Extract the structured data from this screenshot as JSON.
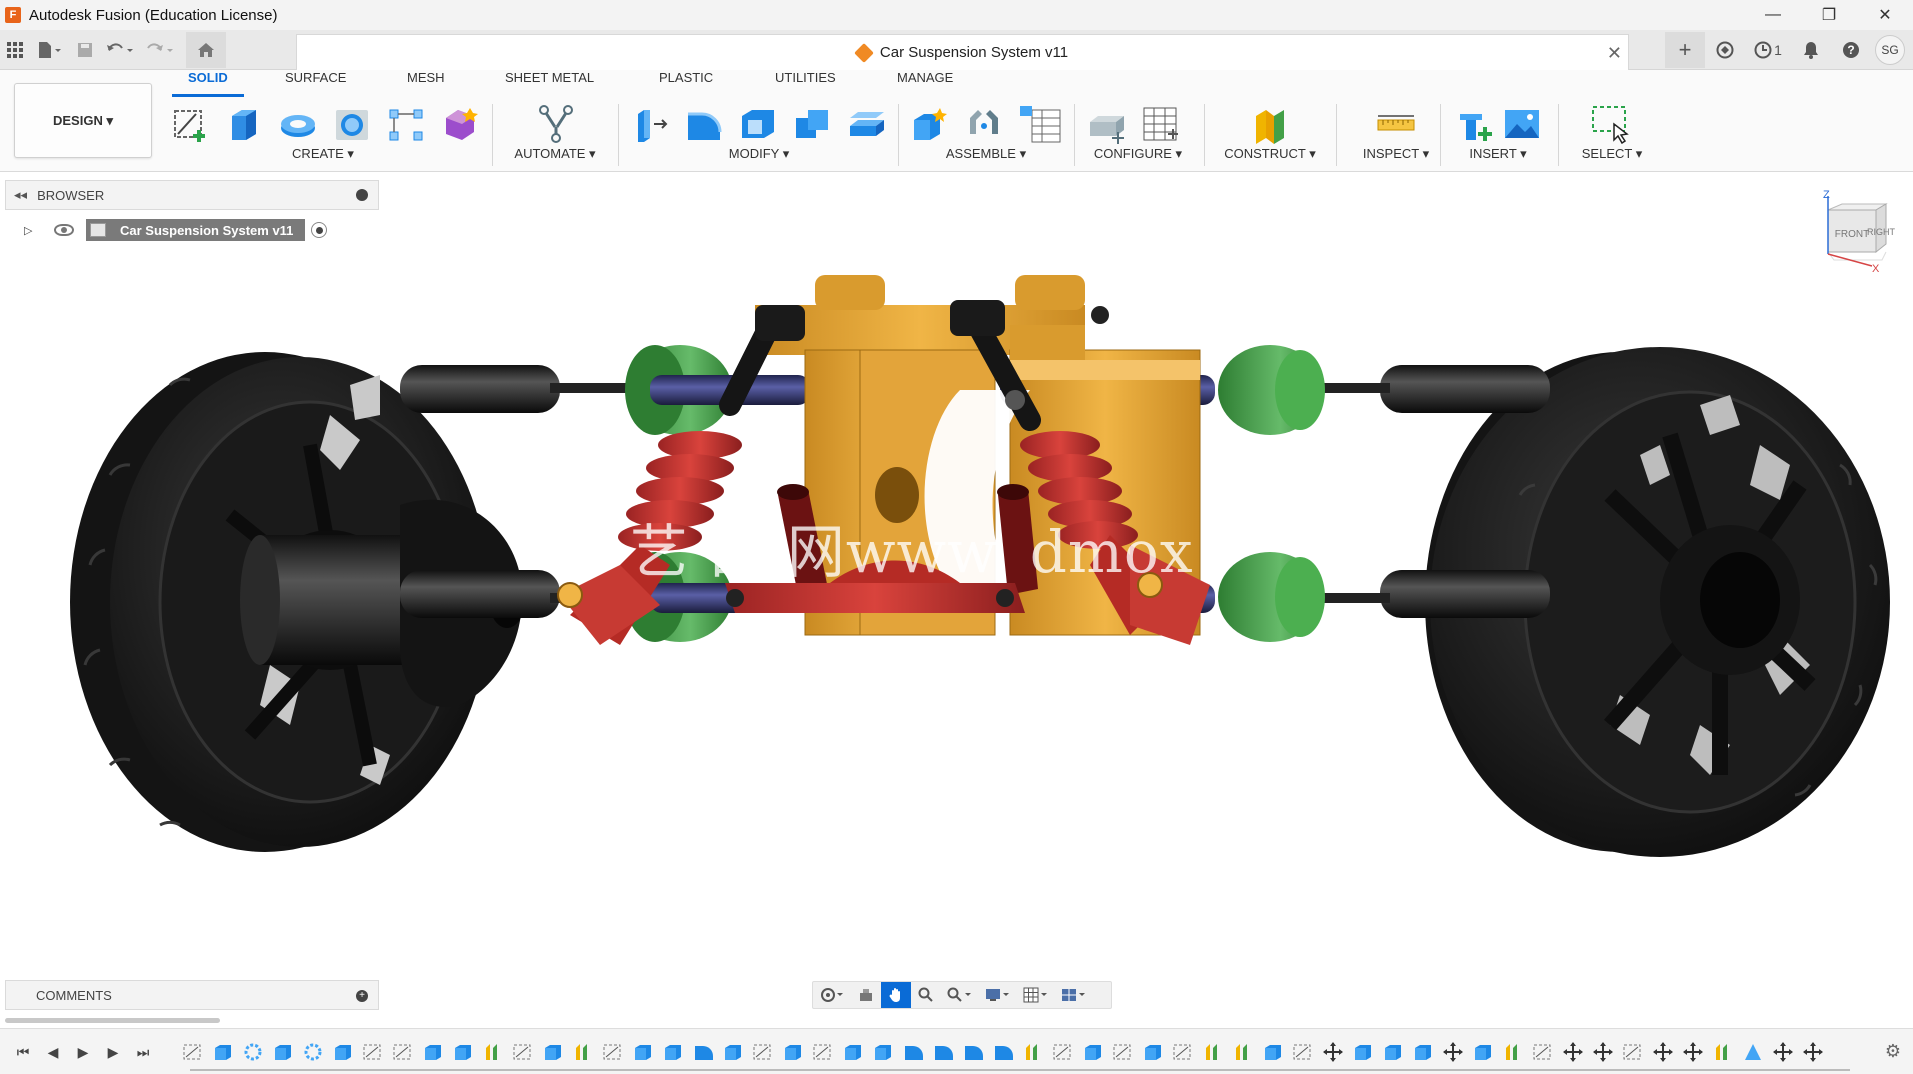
{
  "window": {
    "title": "Autodesk Fusion (Education License)",
    "minimize": "—",
    "restore": "❐",
    "close": "✕"
  },
  "document_tab": {
    "title": "Car Suspension System v11",
    "close": "✕"
  },
  "quick_access": {
    "job_count": "1",
    "avatar_initials": "SG"
  },
  "workspace": {
    "label": "DESIGN ▾"
  },
  "ribbon_tabs": [
    {
      "label": "SOLID",
      "active": true
    },
    {
      "label": "SURFACE",
      "active": false
    },
    {
      "label": "MESH",
      "active": false
    },
    {
      "label": "SHEET METAL",
      "active": false
    },
    {
      "label": "PLASTIC",
      "active": false
    },
    {
      "label": "UTILITIES",
      "active": false
    },
    {
      "label": "MANAGE",
      "active": false
    }
  ],
  "ribbon_groups": {
    "create": "CREATE ▾",
    "automate": "AUTOMATE ▾",
    "modify": "MODIFY ▾",
    "assemble": "ASSEMBLE ▾",
    "configure": "CONFIGURE ▾",
    "construct": "CONSTRUCT ▾",
    "inspect": "INSPECT ▾",
    "insert": "INSERT ▾",
    "select": "SELECT ▾"
  },
  "browser": {
    "title": "BROWSER",
    "root_item": "Car Suspension System v11"
  },
  "viewcube": {
    "front": "FRONT",
    "right": "RIGHT",
    "z": "Z",
    "x": "X"
  },
  "watermark": "艺 西 网www. dmox",
  "comments": {
    "title": "COMMENTS"
  },
  "colors": {
    "accent": "#0a6bd6",
    "frame_yellow": "#e0a83a",
    "spring_red": "#c0392b",
    "bushing_green": "#3f9a3a",
    "tire_black": "#1c1c1c"
  }
}
